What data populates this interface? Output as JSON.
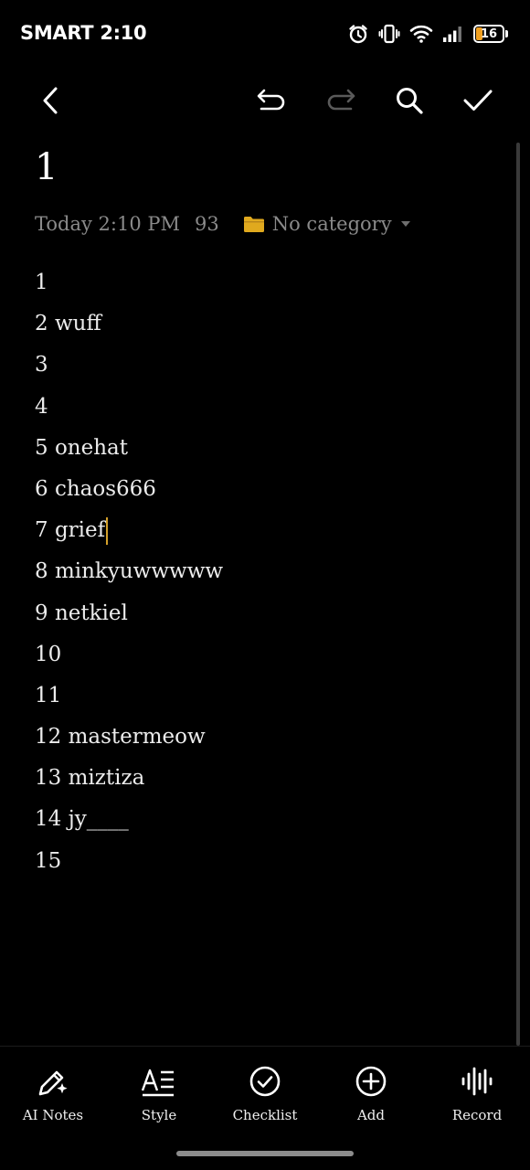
{
  "status_bar": {
    "carrier_time": "SMART 2:10",
    "battery_level": "16",
    "icons": [
      "alarm-icon",
      "vibrate-icon",
      "wifi-icon",
      "signal-icon",
      "battery-icon"
    ]
  },
  "toolbar": {
    "icons": [
      "back-arrow-icon",
      "undo-icon",
      "redo-icon",
      "search-icon",
      "checkmark-icon"
    ]
  },
  "note": {
    "title": "1",
    "date": "Today 2:10 PM",
    "char_count": "93",
    "category": "No category",
    "lines": [
      "1",
      "2 wuff",
      "3",
      "4",
      "5 onehat",
      "6 chaos666",
      "7 grief",
      "8 minkyuwwwww",
      "9 netkiel",
      "10",
      "11",
      "12 mastermeow",
      "13 miztiza",
      "14 jy____",
      "15"
    ]
  },
  "bottom_bar": {
    "items": [
      {
        "label": "AI Notes",
        "icon": "ai-pen-icon"
      },
      {
        "label": "Style",
        "icon": "text-style-icon"
      },
      {
        "label": "Checklist",
        "icon": "check-circle-icon"
      },
      {
        "label": "Add",
        "icon": "plus-circle-icon"
      },
      {
        "label": "Record",
        "icon": "waveform-icon"
      }
    ]
  },
  "colors": {
    "background": "#000000",
    "accent_folder": "#e0a91e",
    "cursor": "#d4a02a",
    "text": "#ececec",
    "muted": "#8a8a8a"
  }
}
